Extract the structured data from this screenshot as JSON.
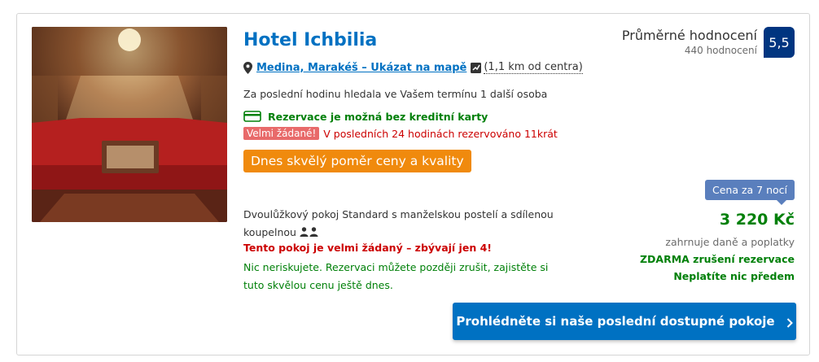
{
  "hotel": {
    "name": "Hotel Ichbilia",
    "address_link": "Medina, Marakéš – Ukázat na mapě",
    "distance": "(1,1 km od centra)",
    "booked_info": "Za poslední hodinu hledala ve Vašem termínu 1 další osoba",
    "no_card": "Rezervace je možná bez kreditní karty",
    "demand_badge": "Velmi žádané!",
    "demand_text": "V posledních 24 hodinách rezervováno 11krát",
    "deal_badge": "Dnes skvělý poměr ceny a kvality",
    "room_desc": "Dvoulůžkový pokoj Standard s manželskou postelí a sdílenou koupelnou",
    "rooms_left": "Tento pokoj je velmi žádaný – zbývají jen 4!",
    "free_cancel_info": "Nic neriskujete. Rezervaci můžete později zrušit, zajistěte si tuto skvělou cenu ještě dnes."
  },
  "rating": {
    "label": "Průměrné hodnocení",
    "reviews": "440 hodnocení",
    "score": "5,5"
  },
  "price": {
    "nights": "Cena za 7 nocí",
    "amount": "3 220 Kč",
    "taxes": "zahrnuje daně a poplatky",
    "free_cancel": "ZDARMA zrušení rezervace",
    "pay_later": "Neplatíte nic předem"
  },
  "cta_label": "Prohlédněte si naše poslední dostupné pokoje",
  "icons": {
    "pin": "map-pin-icon",
    "map": "map-icon",
    "card": "credit-card-icon",
    "persons": "persons-icon",
    "chevron": "chevron-right-icon"
  },
  "colors": {
    "link_blue": "#0071c2",
    "score_bg": "#003580",
    "green": "#008009",
    "deal_orange": "#f08a0d",
    "demand_red": "#cc0000"
  }
}
